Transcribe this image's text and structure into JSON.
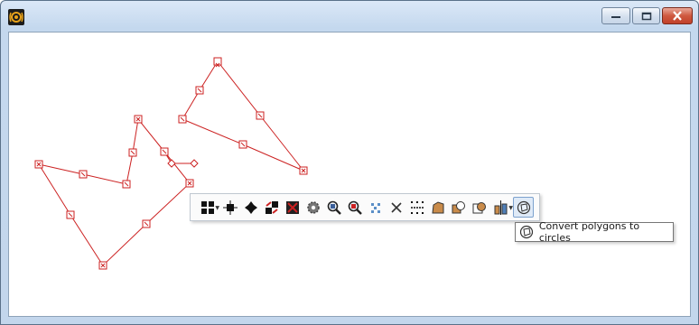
{
  "window": {
    "title": "",
    "icons": {
      "app": "speaker-app-icon",
      "minimize": "minimize-icon",
      "maximize": "maximize-icon",
      "close": "close-icon"
    },
    "accent": "#cf5940"
  },
  "canvas": {
    "stroke_color": "#cc2222",
    "shapes": [
      "polygon-left",
      "polygon-right",
      "polyline-small"
    ]
  },
  "toolbar": {
    "items": [
      {
        "name": "grid-select-icon",
        "has_dropdown": true
      },
      {
        "name": "node-select-icon"
      },
      {
        "name": "node-move-icon"
      },
      {
        "name": "node-swap-icon"
      },
      {
        "name": "delete-shape-icon"
      },
      {
        "name": "gear-icon"
      },
      {
        "name": "zoom-in-icon"
      },
      {
        "name": "zoom-out-icon"
      },
      {
        "name": "scatter-points-icon"
      },
      {
        "name": "cross-icon"
      },
      {
        "name": "dot-grid-icon"
      },
      {
        "name": "polygon-fill-icon"
      },
      {
        "name": "shape-circle-union-icon"
      },
      {
        "name": "shape-circle-subtract-icon"
      },
      {
        "name": "align-icon",
        "has_dropdown": true
      },
      {
        "name": "polygon-to-circle-icon",
        "active": true
      }
    ]
  },
  "tooltip": {
    "text": "Convert polygons to circles",
    "icon": "polygon-to-circle-icon"
  }
}
